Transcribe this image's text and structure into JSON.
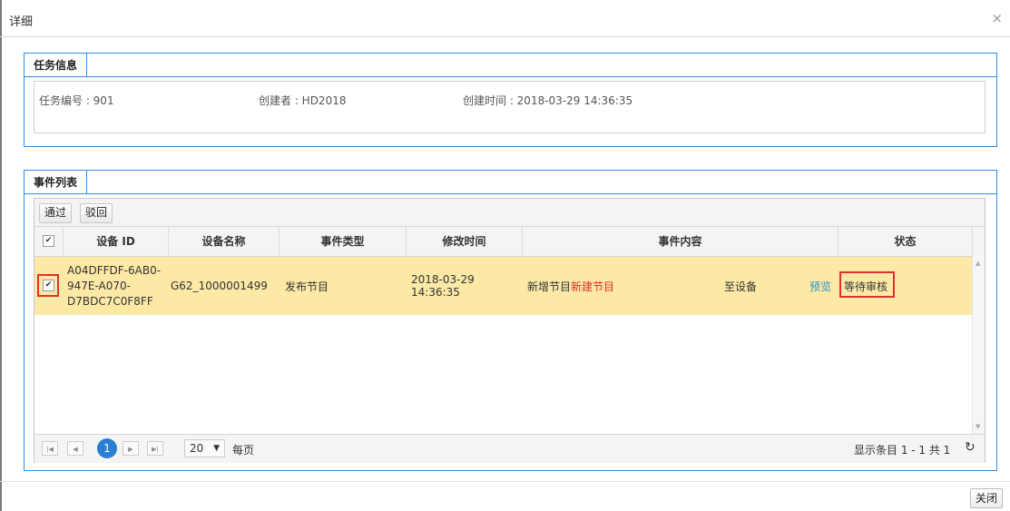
{
  "dialog": {
    "title": "详细",
    "close_icon": "×",
    "close_button": "关闭"
  },
  "task_info": {
    "tab_label": "任务信息",
    "task_no": "任务编号 : 901",
    "creator": "创建者 : HD2018",
    "created_time": "创建时间 : 2018-03-29 14:36:35"
  },
  "event_list": {
    "tab_label": "事件列表",
    "toolbar": {
      "approve": "通过",
      "reject": "驳回"
    },
    "columns": [
      "设备 ID",
      "设备名称",
      "事件类型",
      "修改时间",
      "事件内容",
      "状态"
    ],
    "rows": [
      {
        "checked": true,
        "device_id_lines": [
          "A04DFFDF-6AB0-",
          "947E-A070-",
          "D7BDC7C0F8FF"
        ],
        "device_name": "G62_1000001499",
        "event_type": "发布节目",
        "modified_time": "2018-03-29 14:36:35",
        "content_prefix": "新增节目",
        "content_highlight": "新建节目",
        "content_target": "至设备",
        "preview_link": "预览",
        "status": "等待审核"
      }
    ],
    "pager": {
      "current_page": "1",
      "page_size": "20",
      "per_page_label": "每页",
      "summary": "显示条目 1 - 1 共 1"
    }
  },
  "colors": {
    "accent": "#2e8ee0",
    "row_selected": "#fde9a6",
    "highlight_red": "#e03030",
    "link": "#2a8fc9",
    "page_active": "#2c7fd0"
  }
}
